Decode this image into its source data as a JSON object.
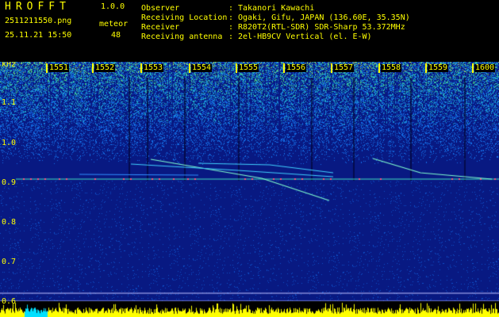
{
  "app": {
    "title": "HROFFT",
    "version": "1.0.0"
  },
  "file": {
    "name": "2511211550.png",
    "datetime": "25.11.21 15:50"
  },
  "meteor": {
    "label": "meteor",
    "count": "48"
  },
  "info": [
    {
      "key": "Observer",
      "value": "Takanori Kawachi"
    },
    {
      "key": "Receiving Location",
      "value": "Ogaki, Gifu, JAPAN (136.60E, 35.35N)"
    },
    {
      "key": "Receiver",
      "value": "R820T2(RTL-SDR) SDR-Sharp 53.372MHz"
    },
    {
      "key": "Receiving antenna",
      "value": "2el-HB9CV Vertical (el. E-W)"
    }
  ],
  "axis": {
    "unit": "kHz",
    "y_ticks": [
      "1.1",
      "1.0",
      "0.9",
      "0.8",
      "0.7",
      "0.6"
    ],
    "time_ticks": [
      "1551",
      "1552",
      "1553",
      "1554",
      "1555",
      "1556",
      "1557",
      "1558",
      "1559",
      "1600"
    ]
  },
  "colors": {
    "text": "#ffff00",
    "background": "#000000",
    "noise_low": "#0a1a8a",
    "noise_high": "#2aa0ff"
  }
}
